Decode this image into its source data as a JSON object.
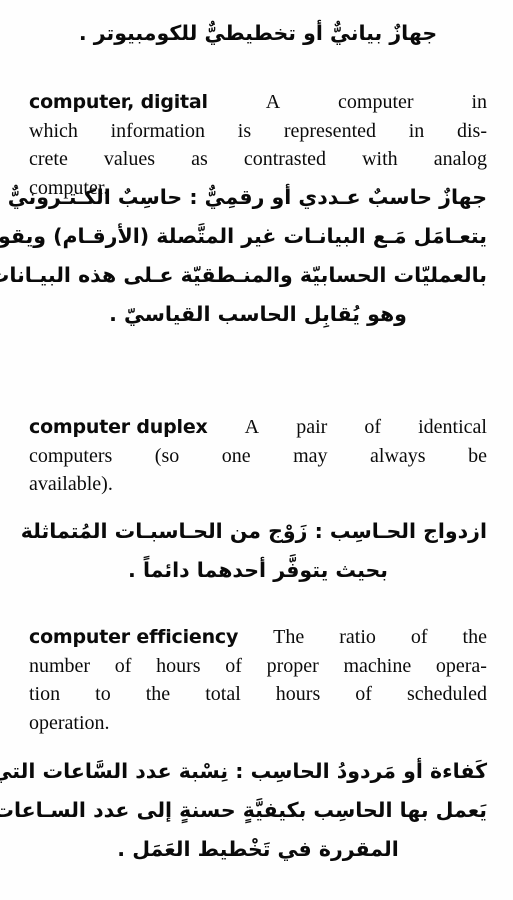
{
  "document": {
    "kind": "scanned-dictionary-page",
    "script_directions": [
      "ltr-english",
      "rtl-arabic"
    ],
    "background_color": "#fefefe",
    "text_color": "#0b0b0b"
  },
  "continuation": {
    "arabic_tail_line": "جهازٌ بيانيٌّ أو تخطيطيٌّ للكومبيوتر ."
  },
  "entries": [
    {
      "id": "computer-digital",
      "headword": "computer, digital",
      "english_lines": [
        [
          "A",
          "computer",
          "in"
        ],
        [
          "which",
          "information",
          "is",
          "represented",
          "in",
          "dis-"
        ],
        [
          "crete",
          "values",
          "as",
          "contrasted",
          "with",
          "analog"
        ],
        [
          "computer."
        ]
      ],
      "english_flat": "computer, digital  A computer in which information is represented in discrete values as contrasted with analog computer.",
      "arabic_lines": [
        "جهازٌ حاسبٌ عـددي أو رقمِيٌّ : حاسِبٌ الكـتـرونيٌّ",
        "يتعـامَل مَـع البيانـات غير المتَّصلة (الأرقـام) ويقوم",
        "بالعمليّات الحسابيّة والمنـطقيّة عـلى هذه البيـانات ،",
        "وهو يُقابِل الحاسب القياسيّ ."
      ],
      "arabic_flat": "جهازٌ حاسبٌ عـددي أو رقمِيٌّ : حاسِبٌ الكـتـرونيٌّ يتعـامَل مَـع البيانـات غير المتَّصلة (الأرقـام) ويقوم بالعمليّات الحسابيّة والمنـطقيّة عـلى هذه البيـانات ، وهو يُقابِل الحاسب القياسيّ ."
    },
    {
      "id": "computer-duplex",
      "headword": "computer duplex",
      "english_lines": [
        [
          "A",
          "pair",
          "of",
          "identical"
        ],
        [
          "computers",
          "(so",
          "one",
          "may",
          "always",
          "be"
        ],
        [
          "available)."
        ]
      ],
      "english_flat": "computer duplex  A pair of identical computers (so one may always be available).",
      "arabic_lines": [
        "ازدواج الحـاسِب : زَوْج من الحـاسبـات المُتماثلة",
        "بحيث يتوفَّر أحدهما دائماً ."
      ],
      "arabic_flat": "ازدواج الحـاسِب : زَوْج من الحـاسبـات المُتماثلة بحيث يتوفَّر أحدهما دائماً ."
    },
    {
      "id": "computer-efficiency",
      "headword": "computer efficiency",
      "english_lines": [
        [
          "The",
          "ratio",
          "of",
          "the"
        ],
        [
          "number",
          "of",
          "hours",
          "of",
          "proper",
          "machine",
          "opera-"
        ],
        [
          "tion",
          "to",
          "the",
          "total",
          "hours",
          "of",
          "scheduled"
        ],
        [
          "operation."
        ]
      ],
      "english_flat": "computer efficiency  The ratio of the number of hours of proper machine operation to the total hours of scheduled operation.",
      "arabic_lines": [
        "كَفاءة أو مَردودُ الحاسِب : نِسْبة عدد السَّاعات التي",
        "يَعمل بها الحاسِب بكيفيَّةٍ حسنةٍ إلى عدد السـاعات",
        "المقررة في تَخْطيط العَمَل ."
      ],
      "arabic_flat": "كَفاءة أو مَردودُ الحاسِب : نِسْبة عدد السَّاعات التي يَعمل بها الحاسِب بكيفيَّةٍ حسنةٍ إلى عدد السـاعات المقررة في تَخْطيط العَمَل ."
    }
  ]
}
